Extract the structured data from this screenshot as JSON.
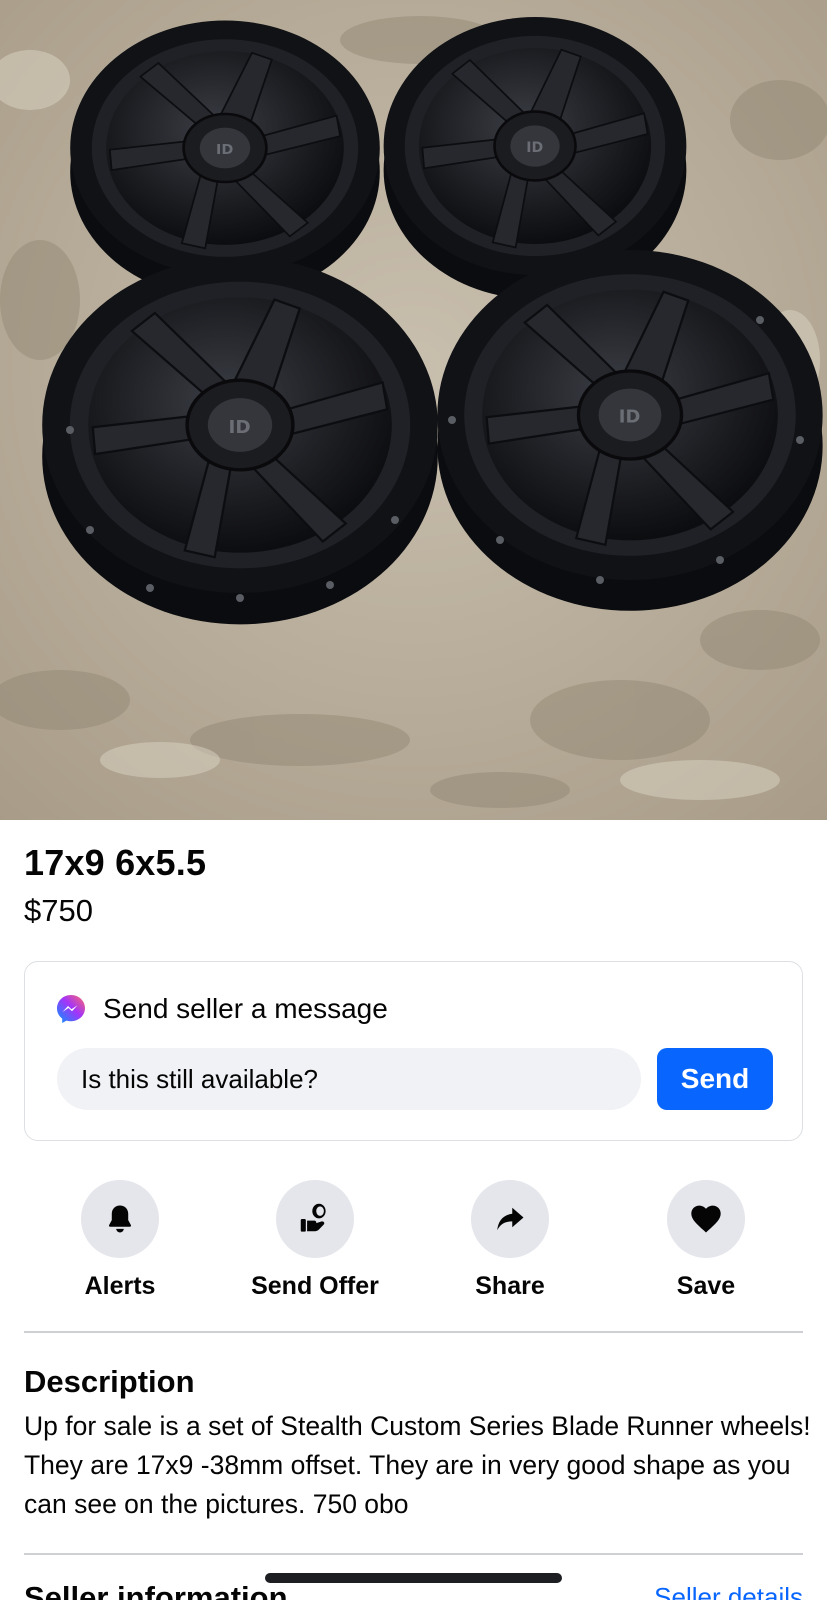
{
  "photo": {
    "alt_icon": "wheels-photo",
    "colors": {
      "floor": "#b7ab97",
      "wheel": "#151618"
    }
  },
  "listing": {
    "title": "17x9 6x5.5",
    "price": "$750"
  },
  "message_card": {
    "header": "Send seller a message",
    "input_value": "Is this still available?",
    "send_label": "Send"
  },
  "actions": [
    {
      "icon": "bell-icon",
      "label": "Alerts"
    },
    {
      "icon": "hand-coin-icon",
      "label": "Send Offer"
    },
    {
      "icon": "share-arrow-icon",
      "label": "Share"
    },
    {
      "icon": "heart-icon",
      "label": "Save"
    }
  ],
  "description": {
    "heading": "Description",
    "body": "Up for sale is a set of Stealth Custom Series Blade Runner wheels! They are 17x9 -38mm offset. They are in very good shape as you can see on the pictures. 750 obo"
  },
  "seller": {
    "heading": "Seller information",
    "link": "Seller details"
  },
  "colors": {
    "accent": "#0866ff",
    "action_bg": "#e4e6eb",
    "input_bg": "#f0f2f5"
  }
}
